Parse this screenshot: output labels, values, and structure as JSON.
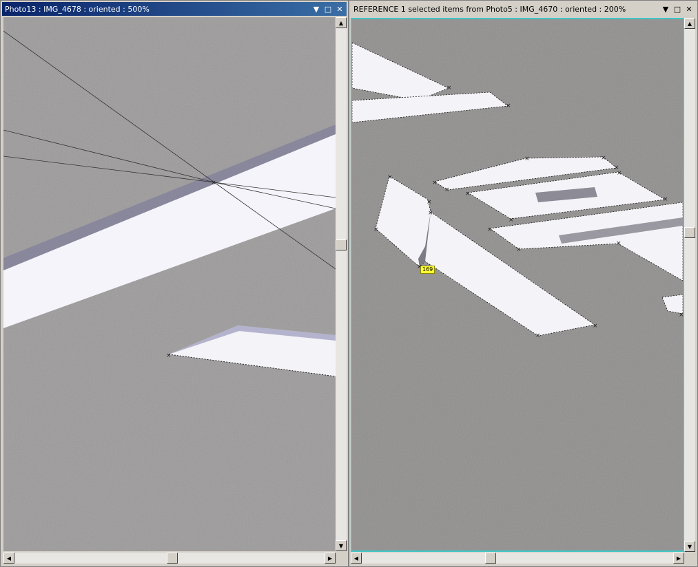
{
  "left_window": {
    "title": "Photo13 : IMG_4678 : oriented : 500%",
    "controls": {
      "menu": "▼",
      "maximize": "□",
      "close": "✕"
    }
  },
  "right_window": {
    "title": "REFERENCE 1 selected items from Photo5 : IMG_4670 : oriented : 200%",
    "controls": {
      "menu": "▼",
      "maximize": "□",
      "close": "✕"
    },
    "marker_label": "169"
  },
  "scroll_glyphs": {
    "up": "▲",
    "down": "▼",
    "left": "◀",
    "right": "▶"
  },
  "colors": {
    "active_title": "#0a246a",
    "asphalt": "#9c9a9a",
    "marking": "#f4f4fa",
    "selection_border": "#3fc6c6",
    "label_bg": "#ffff33"
  }
}
